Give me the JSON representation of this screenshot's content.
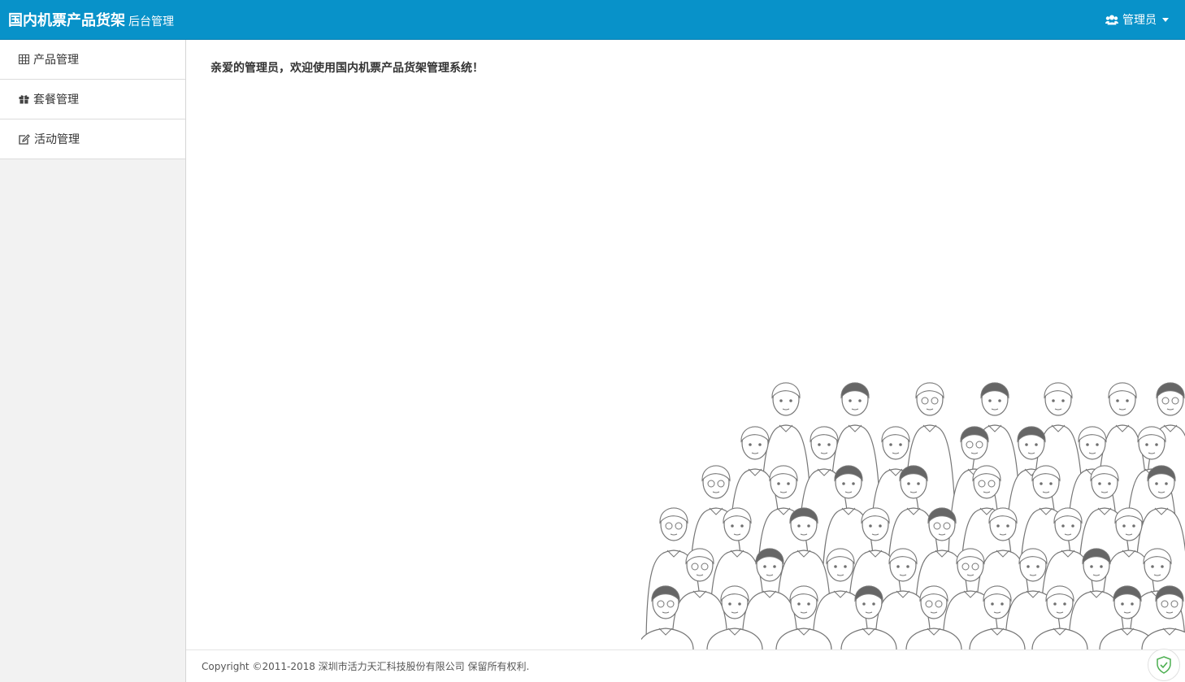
{
  "header": {
    "title": "国内机票产品货架",
    "subtitle": "后台管理",
    "user_label": "管理员",
    "user_icon": "users-icon"
  },
  "sidebar": {
    "items": [
      {
        "label": "产品管理",
        "icon": "table-icon"
      },
      {
        "label": "套餐管理",
        "icon": "gift-icon"
      },
      {
        "label": "活动管理",
        "icon": "edit-icon"
      }
    ]
  },
  "main": {
    "welcome": "亲爱的管理员，欢迎使用国内机票产品货架管理系统！",
    "illustration": "crowd-illustration"
  },
  "footer": {
    "copyright": "Copyright ©2011-2018 深圳市活力天汇科技股份有限公司 保留所有权利."
  },
  "colors": {
    "header_bg": "#0892c9",
    "sidebar_bg": "#f2f2f2",
    "shield_green": "#4caf50"
  }
}
